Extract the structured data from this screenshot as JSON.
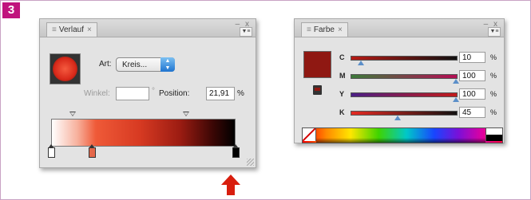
{
  "badge": "3",
  "colors": {
    "badge": "#c0147d",
    "frame_border": "#c9a2c4",
    "selected_color": "#8f1812",
    "arrow": "#d81e0e"
  },
  "gradient_panel": {
    "tab_label": "Verlauf",
    "tab_close": "×",
    "window_controls": "– x",
    "menu_icon": "▼≡",
    "type_label": "Art:",
    "type_value": "Kreis...",
    "angle_label": "Winkel:",
    "angle_value": "",
    "degree_symbol": "°",
    "position_label": "Position:",
    "position_value": "21,91",
    "position_unit": "%",
    "stops": [
      {
        "name": "stop-white",
        "color": "#ffffff",
        "position_pct": 0
      },
      {
        "name": "stop-salmon",
        "color": "#e4674a",
        "position_pct": 22
      },
      {
        "name": "stop-black",
        "color": "#000000",
        "position_pct": 100
      }
    ]
  },
  "color_panel": {
    "tab_label": "Farbe",
    "tab_close": "×",
    "window_controls": "– x",
    "menu_icon": "▼≡",
    "channels": [
      {
        "label": "C",
        "value": "10",
        "unit": "%",
        "level": 0.1,
        "track": "linear-gradient(to right,#b61a14,#111)"
      },
      {
        "label": "M",
        "value": "100",
        "unit": "%",
        "level": 1.0,
        "track": "linear-gradient(to right,#3c7a3a,#b40e54)"
      },
      {
        "label": "Y",
        "value": "100",
        "unit": "%",
        "level": 1.0,
        "track": "linear-gradient(to right,#4a1f86,#c21a1a)"
      },
      {
        "label": "K",
        "value": "45",
        "unit": "%",
        "level": 0.45,
        "track": "linear-gradient(to right,#e52a22,#111)"
      }
    ]
  }
}
